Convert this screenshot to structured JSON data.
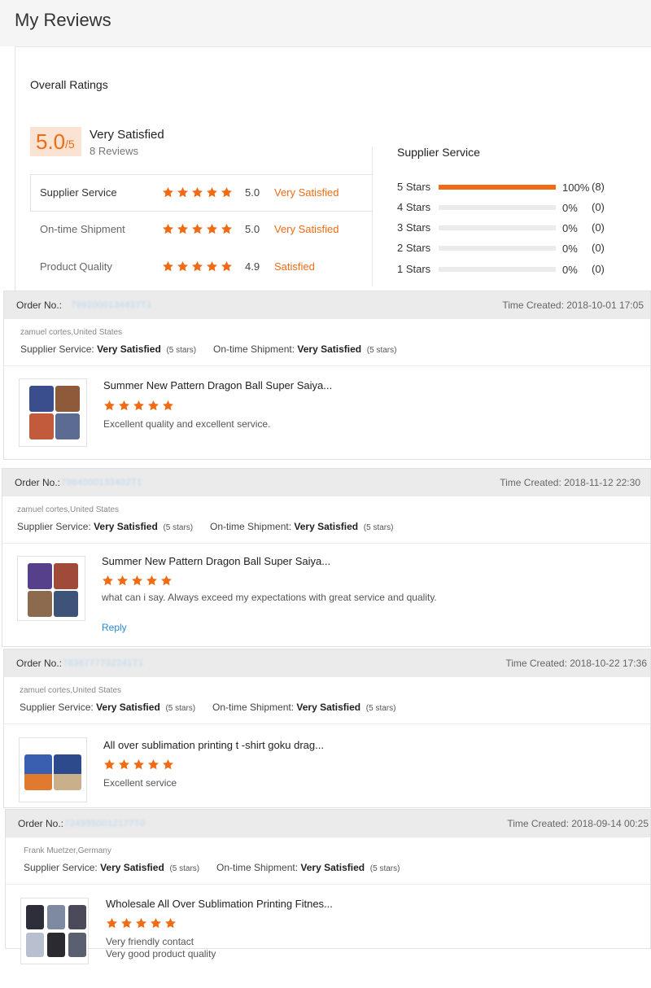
{
  "page": {
    "title": "My Reviews"
  },
  "overall": {
    "title": "Overall Ratings",
    "score": "5.0",
    "score_den": "/5",
    "satisfaction": "Very Satisfied",
    "reviews": "8 Reviews",
    "ratings": [
      {
        "label": "Supplier Service",
        "stars": 5,
        "value": "5.0",
        "text": "Very Satisfied"
      },
      {
        "label": "On-time Shipment",
        "stars": 5,
        "value": "5.0",
        "text": "Very Satisfied"
      },
      {
        "label": "Product Quality",
        "stars": 5,
        "value": "4.9",
        "text": "Satisfied"
      }
    ]
  },
  "supplier_service": {
    "title": "Supplier Service",
    "bars": [
      {
        "label": "5 Stars",
        "fraction": 1.0,
        "pct": "100%",
        "count": "(8)"
      },
      {
        "label": "4 Stars",
        "fraction": 0,
        "pct": "0%",
        "count": "(0)"
      },
      {
        "label": "3 Stars",
        "fraction": 0,
        "pct": "0%",
        "count": "(0)"
      },
      {
        "label": "2 Stars",
        "fraction": 0,
        "pct": "0%",
        "count": "(0)"
      },
      {
        "label": "1 Stars",
        "fraction": 0,
        "pct": "0%",
        "count": "(0)"
      }
    ]
  },
  "reviews": [
    {
      "order_label": "Order No.:",
      "order_number": "7992000134437T1",
      "time": "Time Created: 2018-10-01 17:05",
      "reviewer": "zamuel cortes,United States",
      "supplier_label": "Supplier Service:",
      "supplier_value": "Very Satisfied",
      "supplier_stars": "(5 stars)",
      "shipment_label": "On-time Shipment:",
      "shipment_value": "Very Satisfied",
      "shipment_stars": "(5 stars)",
      "product_title": "Summer New Pattern Dragon Ball Super Saiya...",
      "rating": 5,
      "comment_lines": [
        "Excellent quality and excellent service."
      ],
      "reply": ""
    },
    {
      "order_label": "Order No.:",
      "order_number": "7984000133402T1",
      "time": "Time Created: 2018-11-12 22:30",
      "reviewer": "zamuel cortes,United States",
      "supplier_label": "Supplier Service:",
      "supplier_value": "Very Satisfied",
      "supplier_stars": "(5 stars)",
      "shipment_label": "On-time Shipment:",
      "shipment_value": "Very Satisfied",
      "shipment_stars": "(5 stars)",
      "product_title": "Summer New Pattern Dragon Ball Super Saiya...",
      "rating": 5,
      "comment_lines": [
        "what can i say. Always exceed my expectations with great service and quality."
      ],
      "reply": "Reply"
    },
    {
      "order_label": "Order No.:",
      "order_number": "7838777732241T1",
      "time": "Time Created: 2018-10-22 17:36",
      "reviewer": "zamuel cortes,United States",
      "supplier_label": "Supplier Service:",
      "supplier_value": "Very Satisfied",
      "supplier_stars": "(5 stars)",
      "shipment_label": "On-time Shipment:",
      "shipment_value": "Very Satisfied",
      "shipment_stars": "(5 stars)",
      "product_title": "All over sublimation printing t -shirt goku drag...",
      "rating": 5,
      "comment_lines": [
        "Excellent service"
      ],
      "reply": ""
    },
    {
      "order_label": "Order No.:",
      "order_number": "7249950012177T0",
      "time": "Time Created: 2018-09-14 00:25",
      "reviewer": "Frank Muetzer,Germany",
      "supplier_label": "Supplier Service:",
      "supplier_value": "Very Satisfied",
      "supplier_stars": "(5 stars)",
      "shipment_label": "On-time Shipment:",
      "shipment_value": "Very Satisfied",
      "shipment_stars": "(5 stars)",
      "product_title": "Wholesale All Over Sublimation Printing Fitnes...",
      "rating": 5,
      "comment_lines": [
        "Very friendly contact",
        "Very good product quality"
      ],
      "reply": ""
    }
  ],
  "colors": {
    "accent": "#f06b14",
    "score_bg": "#fbe3d4",
    "link": "#2a8ad4",
    "header_bg": "#ebebeb"
  }
}
